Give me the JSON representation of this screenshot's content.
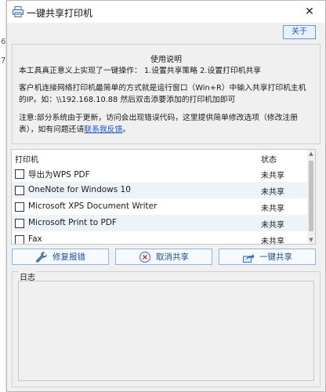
{
  "background": {
    "chars": [
      "6",
      "7"
    ]
  },
  "window": {
    "title": "一键共享打印机",
    "close_glyph": "✕"
  },
  "about_button": "关于",
  "info": {
    "heading": "使用说明",
    "line1": "本工具真正意义上实现了一键操作：  1.设置共享策略  2.设置打印机共享",
    "line2": "客户机连接网络打印机最简单的方式就是运行窗口（Win+R）中输入共享打印机主机的IP。如：\\\\192.168.10.88  然后双击添要添加的打印机加即可",
    "line3_prefix": "注意:部分系统由于更新，访问会出现错误代码，这里提供简单修改选项（修改注册表），如有问题还请",
    "line3_link": "联系我反馈",
    "line3_suffix": "。"
  },
  "printer_list": {
    "columns": {
      "name": "打印机",
      "status": "状态"
    },
    "rows": [
      {
        "name": "导出为WPS PDF",
        "status": "未共享"
      },
      {
        "name": "OneNote for Windows 10",
        "status": "未共享"
      },
      {
        "name": "Microsoft XPS Document Writer",
        "status": "未共享"
      },
      {
        "name": "Microsoft Print to PDF",
        "status": "未共享"
      },
      {
        "name": "Fax",
        "status": "未共享"
      }
    ]
  },
  "actions": {
    "repair": "修复报错",
    "cancel_share": "取消共享",
    "one_click_share": "一键共享"
  },
  "log": {
    "label": "日志",
    "content": ""
  },
  "colors": {
    "accent": "#1a5fa8",
    "link": "#1d4fd1",
    "row_alt": "#eef3fa"
  }
}
